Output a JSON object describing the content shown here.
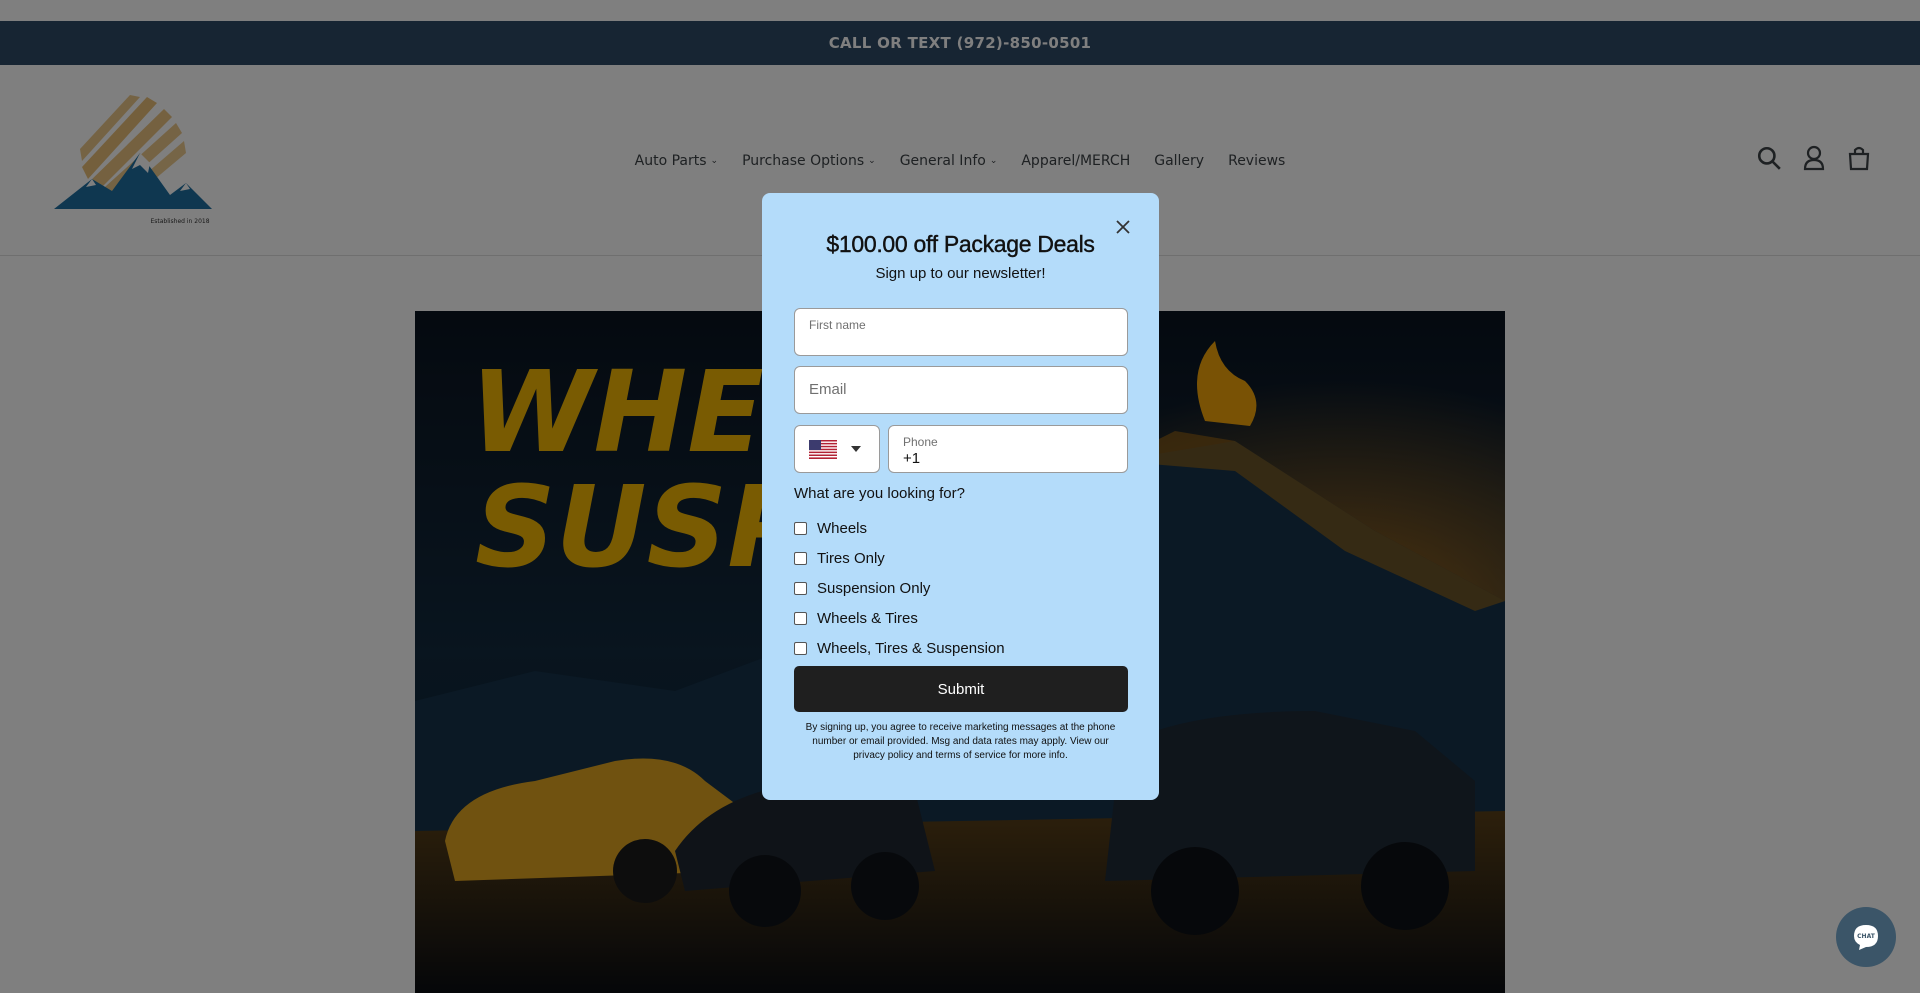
{
  "announcement": {
    "text": "CALL OR TEXT (972)-850-0501"
  },
  "logo": {
    "tagline": "Established in 2018"
  },
  "nav": {
    "items": [
      {
        "label": "Auto Parts",
        "has_dropdown": true
      },
      {
        "label": "Purchase Options",
        "has_dropdown": true
      },
      {
        "label": "General Info",
        "has_dropdown": true
      },
      {
        "label": "Apparel/MERCH",
        "has_dropdown": false
      },
      {
        "label": "Gallery",
        "has_dropdown": false
      },
      {
        "label": "Reviews",
        "has_dropdown": false
      }
    ],
    "dropdown_caret": "⌄"
  },
  "header_icons": [
    "search-icon",
    "account-icon",
    "cart-icon"
  ],
  "hero": {
    "headline_line1": "WHEEL",
    "headline_line2": "SUSPE"
  },
  "popup": {
    "title": "$100.00 off Package Deals",
    "subtitle": "Sign up to our newsletter!",
    "first_name_label": "First name",
    "email_placeholder": "Email",
    "phone_label": "Phone",
    "phone_value": "+1",
    "country_flag": "us-flag-icon",
    "question": "What are you looking for?",
    "options": [
      "Wheels",
      "Tires Only",
      "Suspension Only",
      "Wheels & Tires",
      "Wheels, Tires & Suspension"
    ],
    "submit_label": "Submit",
    "legal_text": "By signing up, you agree to receive marketing messages at the phone number or email provided. Msg and data rates may apply. View our privacy policy and terms of service for more info."
  },
  "chat": {
    "label": "CHAT"
  },
  "colors": {
    "announcement_bg": "#2f4a66",
    "popup_bg": "#b4dcfa",
    "submit_bg": "#1f1f1f",
    "hero_title": "#f2b705"
  }
}
